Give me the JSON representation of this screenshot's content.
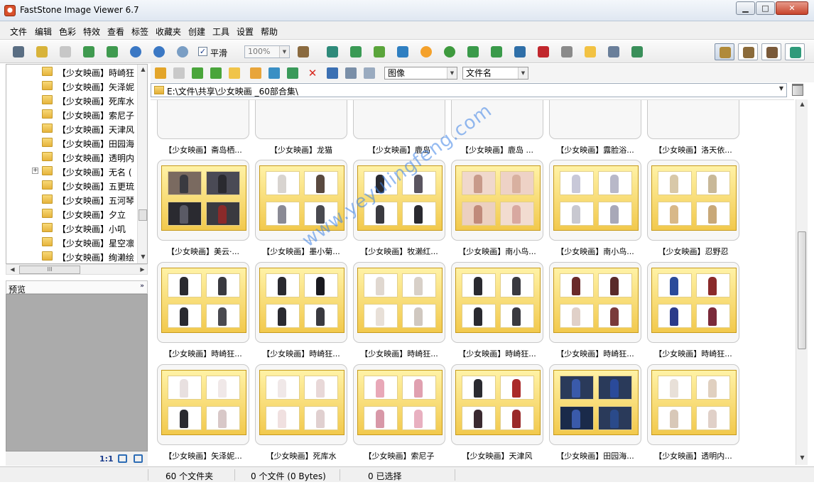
{
  "window": {
    "title": "FastStone Image Viewer 6.7"
  },
  "menu": [
    "文件",
    "编辑",
    "色彩",
    "特效",
    "查看",
    "标签",
    "收藏夹",
    "创建",
    "工具",
    "设置",
    "帮助"
  ],
  "toolbar": {
    "smooth_checked_mark": "✓",
    "smooth_label": "平滑",
    "zoom_value": "100%"
  },
  "tree": {
    "items": [
      "【少女映画】時崎狂",
      "【少女映画】矢泽妮",
      "【少女映画】死库水",
      "【少女映画】索尼子",
      "【少女映画】天津风",
      "【少女映画】田园海",
      "【少女映画】透明内",
      "【少女映画】无名 (",
      "【少女映画】五更琉",
      "【少女映画】五河琴",
      "【少女映画】夕立",
      "【少女映画】小叽",
      "【少女映画】星空凛",
      "【少女映画】绚濑绘"
    ],
    "expandable_index": 7,
    "expander_symbol": "+",
    "hscroll_grip": "III"
  },
  "preview": {
    "label": "预览",
    "toggle": "»",
    "ratio": "1:1"
  },
  "browser": {
    "view_filter": "图像",
    "sort_by": "文件名",
    "path": "E:\\文件\\共享\\少女映画 _60部合集\\"
  },
  "thumbnails": {
    "row_cropped": [
      "【少女映画】斋岛栖...",
      "【少女映画】龙猫",
      "【少女映画】鹿岛",
      "【少女映画】鹿岛 ...",
      "【少女映画】露脸浴...",
      "【少女映画】洛天依..."
    ],
    "row1": [
      "【少女映画】美云·...",
      "【少女映画】墨小菊...",
      "【少女映画】牧濑红...",
      "【少女映画】南小鸟...",
      "【少女映画】南小鸟...",
      "【少女映画】忍野忍"
    ],
    "row2": [
      "【少女映画】時崎狂...",
      "【少女映画】時崎狂...",
      "【少女映画】時崎狂...",
      "【少女映画】時崎狂...",
      "【少女映画】時崎狂...",
      "【少女映画】時崎狂..."
    ],
    "row3": [
      "【少女映画】矢泽妮...",
      "【少女映画】死库水",
      "【少女映画】索尼子",
      "【少女映画】天津风",
      "【少女映画】田园海...",
      "【少女映画】透明内..."
    ]
  },
  "watermark": "www.yeyulingfeng.com",
  "status": {
    "folders": "60 个文件夹",
    "files": "0 个文件 (0 Bytes)",
    "selected": "0 已选择"
  },
  "colors": {
    "accent": "#2d6cb5",
    "thumb_frame": "#f2c94d",
    "close_button": "#c7442c"
  }
}
